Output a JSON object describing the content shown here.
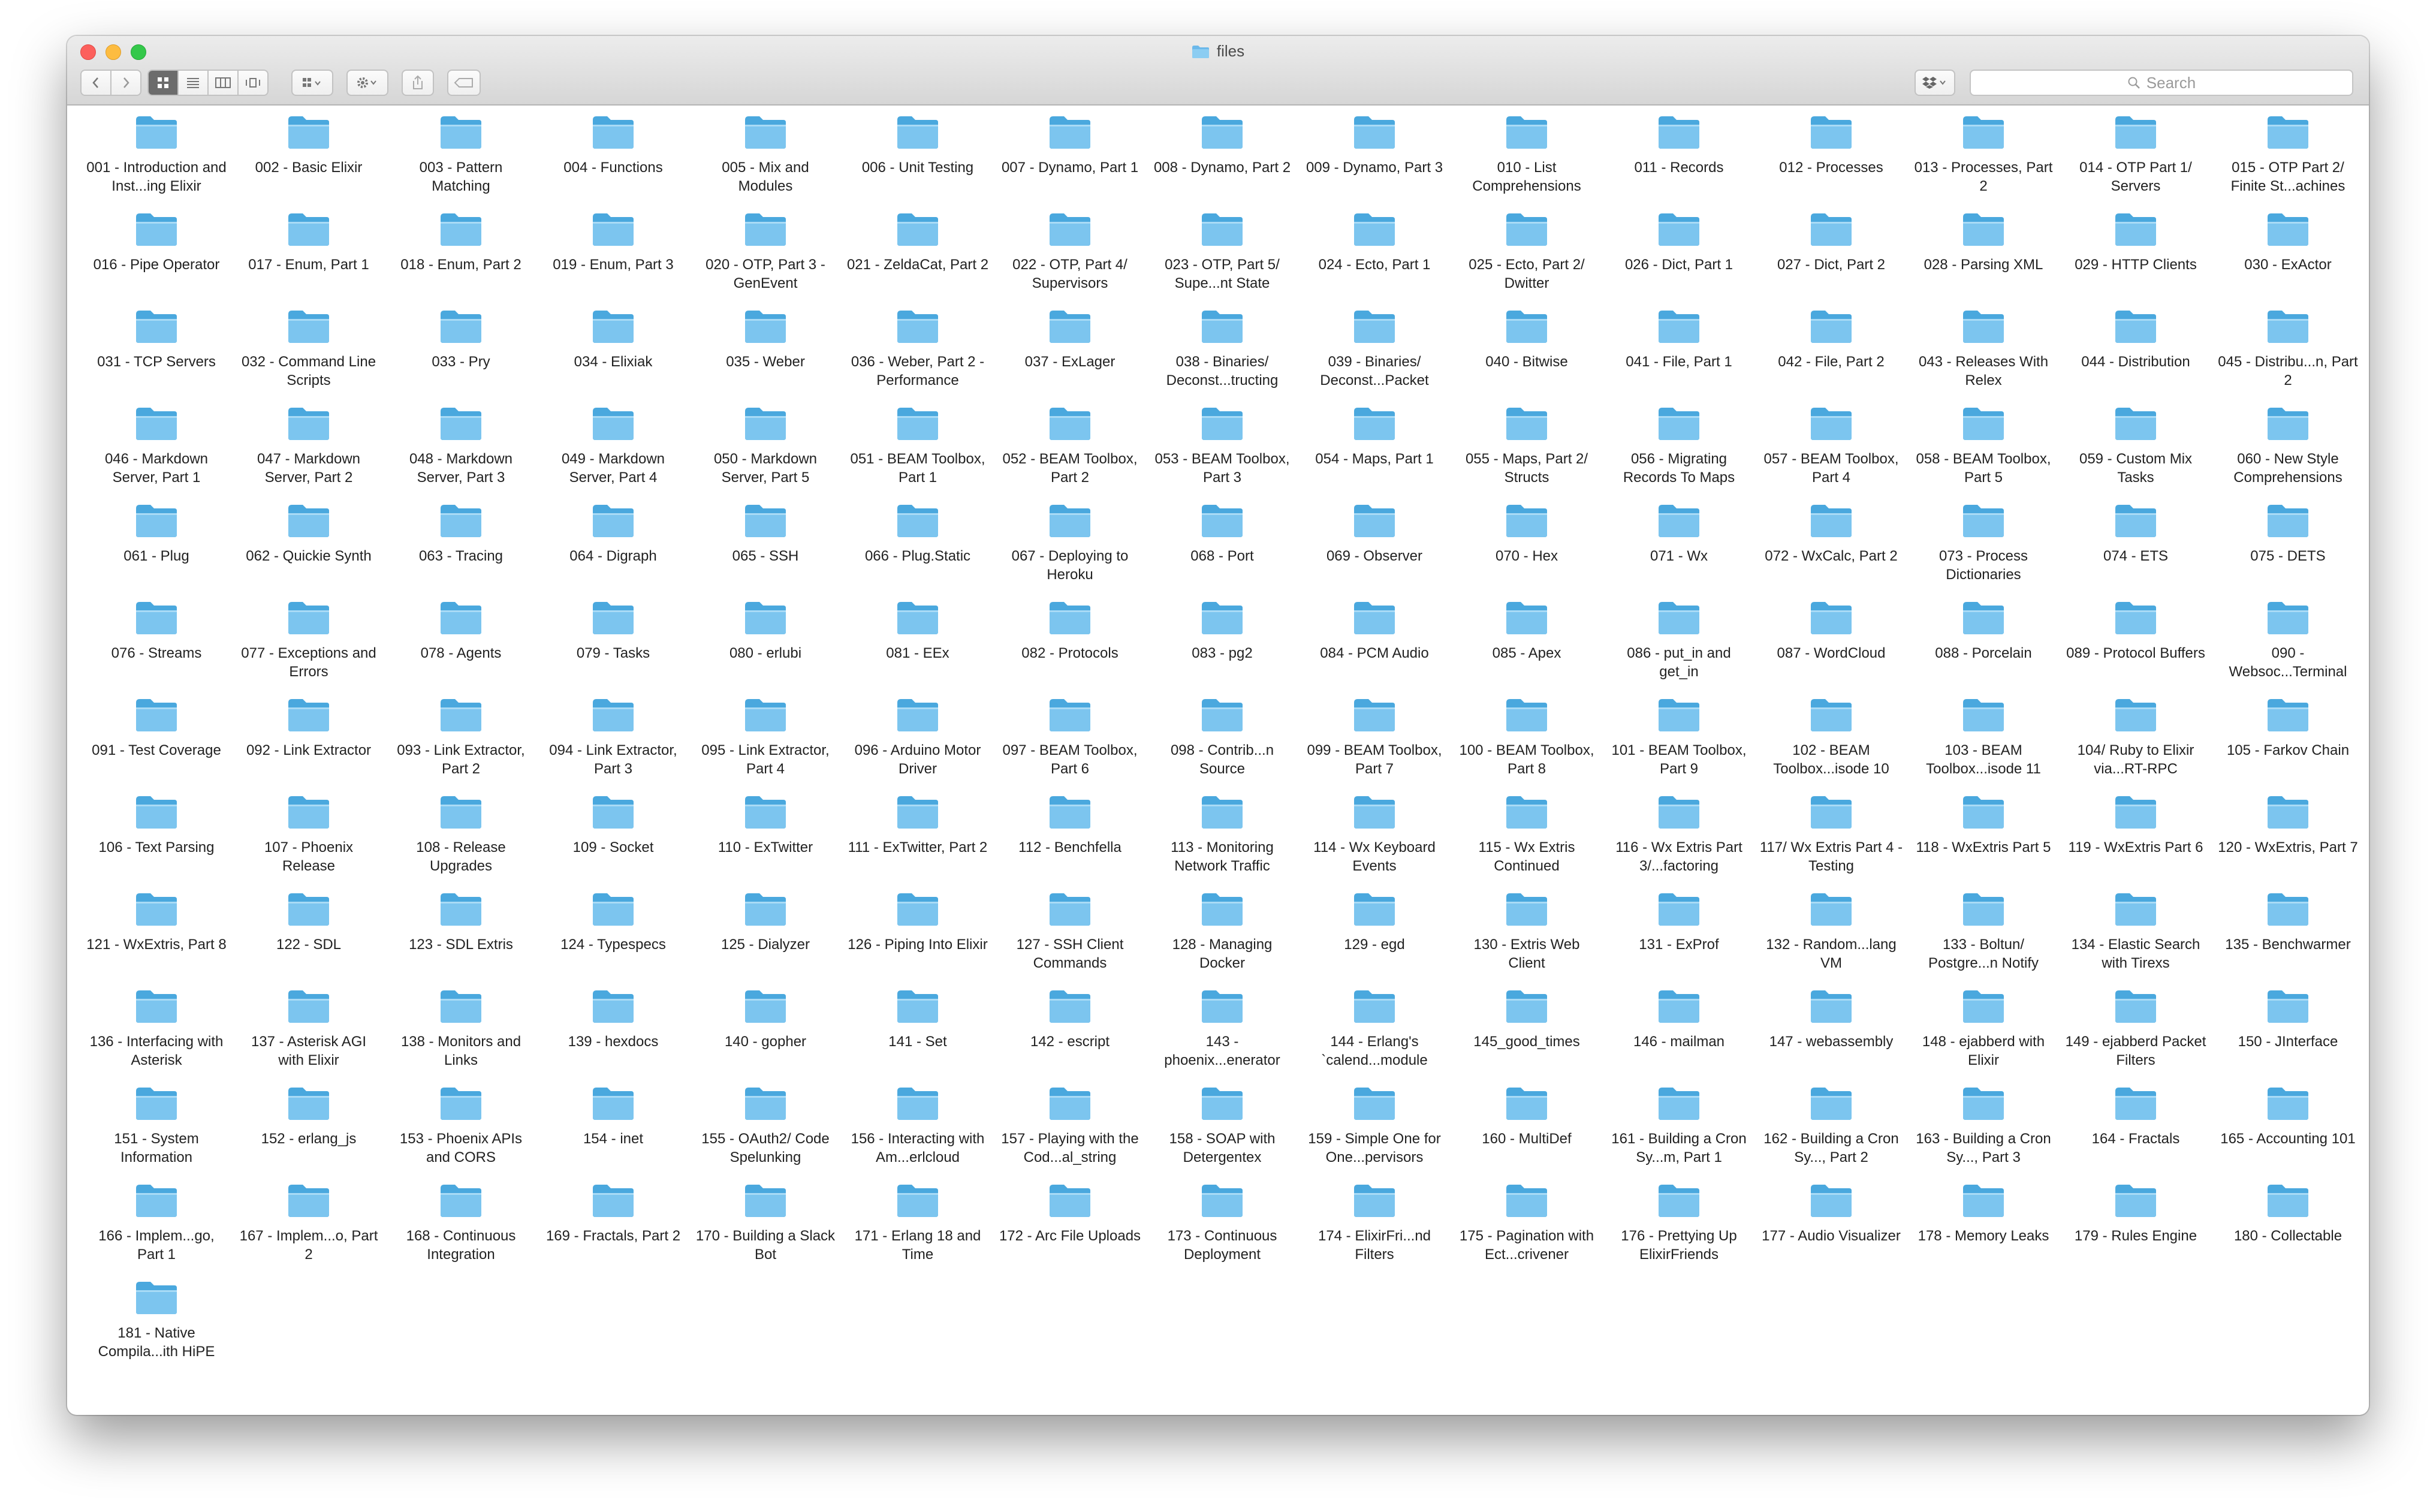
{
  "window": {
    "title": "files"
  },
  "toolbar": {
    "back_icon": "chevron-left-icon",
    "forward_icon": "chevron-right-icon",
    "view_modes": [
      "icon-view-icon",
      "list-view-icon",
      "column-view-icon",
      "cover-flow-icon"
    ],
    "search": {
      "placeholder": "Search"
    }
  },
  "colors": {
    "folder_front": "#7cc5ef",
    "folder_back": "#4aa8de",
    "title_folder": "#6bb8ea"
  },
  "files": [
    "001 - Introduction and Inst...ing Elixir",
    "002 - Basic Elixir",
    "003 - Pattern Matching",
    "004 - Functions",
    "005 - Mix and Modules",
    "006 - Unit Testing",
    "007 - Dynamo, Part 1",
    "008 - Dynamo, Part 2",
    "009 - Dynamo, Part 3",
    "010 - List Comprehensions",
    "011 - Records",
    "012 - Processes",
    "013 - Processes, Part 2",
    "014 - OTP Part 1/ Servers",
    "015 - OTP Part 2/ Finite St...achines",
    "016 - Pipe Operator",
    "017 - Enum, Part 1",
    "018 - Enum, Part 2",
    "019 - Enum, Part 3",
    "020 - OTP, Part 3 - GenEvent",
    "021 - ZeldaCat, Part 2",
    "022 - OTP, Part 4/ Supervisors",
    "023 - OTP, Part 5/ Supe...nt State",
    "024 - Ecto, Part 1",
    "025 - Ecto, Part 2/ Dwitter",
    "026 - Dict, Part 1",
    "027 - Dict, Part 2",
    "028 - Parsing XML",
    "029 - HTTP Clients",
    "030 - ExActor",
    "031 - TCP Servers",
    "032 - Command Line Scripts",
    "033 - Pry",
    "034 - Elixiak",
    "035 - Weber",
    "036 - Weber, Part 2 - Performance",
    "037 - ExLager",
    "038 - Binaries/ Deconst...tructing",
    "039 - Binaries/ Deconst...Packet",
    "040 - Bitwise",
    "041 - File, Part 1",
    "042 - File, Part 2",
    "043 - Releases With Relex",
    "044 - Distribution",
    "045 - Distribu...n, Part 2",
    "046 - Markdown Server, Part 1",
    "047 - Markdown Server, Part 2",
    "048 - Markdown Server, Part 3",
    "049 - Markdown Server, Part 4",
    "050 - Markdown Server, Part 5",
    "051 - BEAM Toolbox, Part 1",
    "052 - BEAM Toolbox, Part 2",
    "053 - BEAM Toolbox, Part 3",
    "054 - Maps, Part 1",
    "055 - Maps, Part 2/ Structs",
    "056 - Migrating Records To Maps",
    "057 - BEAM Toolbox, Part 4",
    "058 - BEAM Toolbox, Part 5",
    "059 - Custom Mix Tasks",
    "060 - New Style Comprehensions",
    "061 - Plug",
    "062 - Quickie Synth",
    "063 - Tracing",
    "064 - Digraph",
    "065 - SSH",
    "066 - Plug.Static",
    "067 - Deploying to Heroku",
    "068 - Port",
    "069 - Observer",
    "070 - Hex",
    "071 - Wx",
    "072 - WxCalc, Part 2",
    "073 - Process Dictionaries",
    "074 - ETS",
    "075 - DETS",
    "076 - Streams",
    "077 - Exceptions and Errors",
    "078 - Agents",
    "079 - Tasks",
    "080 - erlubi",
    "081 - EEx",
    "082 - Protocols",
    "083 - pg2",
    "084 - PCM Audio",
    "085 - Apex",
    "086 - put_in and get_in",
    "087 - WordCloud",
    "088 - Porcelain",
    "089 - Protocol Buffers",
    "090 - Websoc...Terminal",
    "091 - Test Coverage",
    "092 - Link Extractor",
    "093 - Link Extractor, Part 2",
    "094 - Link Extractor, Part 3",
    "095 - Link Extractor, Part 4",
    "096 - Arduino Motor Driver",
    "097 - BEAM Toolbox, Part 6",
    "098 - Contrib...n Source",
    "099 - BEAM Toolbox, Part 7",
    "100 - BEAM Toolbox, Part 8",
    "101 - BEAM Toolbox, Part 9",
    "102 - BEAM Toolbox...isode 10",
    "103 - BEAM Toolbox...isode 11",
    "104/ Ruby to Elixir via...RT-RPC",
    "105 - Farkov Chain",
    "106 - Text Parsing",
    "107 - Phoenix Release",
    "108 - Release Upgrades",
    "109 - Socket",
    "110 - ExTwitter",
    "111 - ExTwitter, Part 2",
    "112 - Benchfella",
    "113 - Monitoring Network Traffic",
    "114 - Wx Keyboard Events",
    "115 - Wx Extris Continued",
    "116 - Wx Extris Part 3/...factoring",
    "117/ Wx Extris Part 4 - Testing",
    "118 - WxExtris Part 5",
    "119 - WxExtris Part 6",
    "120 - WxExtris, Part 7",
    "121 - WxExtris, Part 8",
    "122 - SDL",
    "123 - SDL Extris",
    "124 - Typespecs",
    "125 - Dialyzer",
    "126 - Piping Into Elixir",
    "127 - SSH Client Commands",
    "128 - Managing Docker",
    "129 - egd",
    "130 - Extris Web Client",
    "131 - ExProf",
    "132 - Random...lang VM",
    "133 - Boltun/ Postgre...n Notify",
    "134 - Elastic Search with Tirexs",
    "135 - Benchwarmer",
    "136 - Interfacing with Asterisk",
    "137 - Asterisk AGI with Elixir",
    "138 - Monitors and Links",
    "139 - hexdocs",
    "140 - gopher",
    "141 - Set",
    "142 - escript",
    "143 - phoenix...enerator",
    "144 - Erlang's `calend...module",
    "145_good_times",
    "146 - mailman",
    "147 - webassembly",
    "148 - ejabberd with Elixir",
    "149 - ejabberd Packet Filters",
    "150 - JInterface",
    "151 - System Information",
    "152 - erlang_js",
    "153 - Phoenix APIs and CORS",
    "154 - inet",
    "155 - OAuth2/ Code Spelunking",
    "156 - Interacting with Am...erlcloud",
    "157 - Playing with the Cod...al_string",
    "158 - SOAP with Detergentex",
    "159 - Simple One for One...pervisors",
    "160 - MultiDef",
    "161 - Building a Cron Sy...m, Part 1",
    "162 - Building a Cron Sy..., Part 2",
    "163 - Building a Cron Sy..., Part 3",
    "164 - Fractals",
    "165 - Accounting 101",
    "166 - Implem...go, Part 1",
    "167 - Implem...o, Part 2",
    "168 - Continuous Integration",
    "169 - Fractals, Part 2",
    "170 - Building a Slack Bot",
    "171 - Erlang 18 and Time",
    "172 - Arc File Uploads",
    "173 - Continuous Deployment",
    "174 - ElixirFri...nd Filters",
    "175 - Pagination with Ect...crivener",
    "176 - Prettying Up ElixirFriends",
    "177 - Audio Visualizer",
    "178 - Memory Leaks",
    "179 - Rules Engine",
    "180 - Collectable",
    "181 - Native Compila...ith HiPE"
  ]
}
